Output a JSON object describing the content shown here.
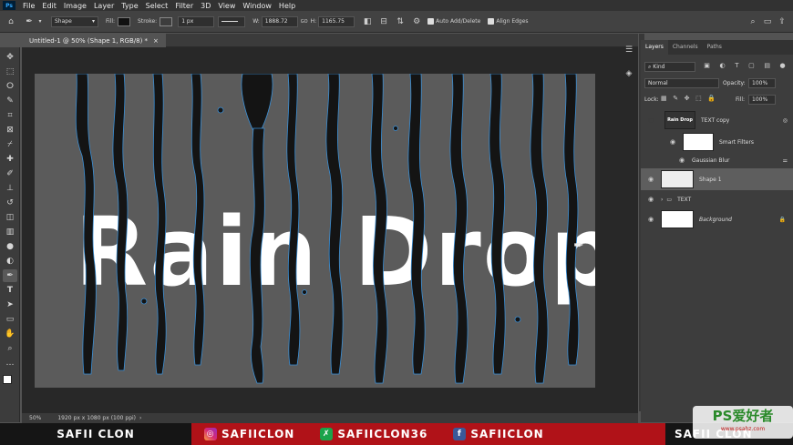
{
  "menubar": {
    "logo": "Ps",
    "items": [
      "File",
      "Edit",
      "Image",
      "Layer",
      "Type",
      "Select",
      "Filter",
      "3D",
      "View",
      "Window",
      "Help"
    ]
  },
  "options": {
    "mode": "Shape",
    "fill_label": "Fill:",
    "stroke_label": "Stroke:",
    "stroke_size": "1 px",
    "w_label": "W:",
    "w_value": "1888.72",
    "go_label": "GO",
    "h_label": "H:",
    "h_value": "1165.75",
    "auto_add": "Auto Add/Delete",
    "align_edges": "Align Edges"
  },
  "document": {
    "tab_title": "Untitled-1 @ 50% (Shape 1, RGB/8) *",
    "text": "Rain Drop"
  },
  "status": {
    "zoom": "50%",
    "info": "1920 px x 1080 px (100 ppi)"
  },
  "layers_panel": {
    "tabs": [
      "Layers",
      "Channels",
      "Paths"
    ],
    "kind": "Kind",
    "blend_mode": "Normal",
    "opacity_label": "Opacity:",
    "opacity_value": "100%",
    "lock_label": "Lock:",
    "fill_label": "Fill:",
    "fill_value": "100%",
    "layers": [
      {
        "name": "TEXT copy",
        "thumb_text": "Rain Drop"
      },
      {
        "name": "Smart Filters"
      },
      {
        "name": "Gaussian Blur"
      },
      {
        "name": "Shape 1"
      },
      {
        "name": "TEXT"
      },
      {
        "name": "Background"
      }
    ]
  },
  "banner": {
    "left_name": "SAFII CLON",
    "instagram": "SAFIICLON",
    "other": "SAFIICLON36",
    "facebook": "SAFIICLON",
    "right_name": "SAFII CLON"
  },
  "watermark": {
    "text": "PS爱好者",
    "url": "www.psahz.com"
  },
  "colors": {
    "accent": "#31a8ff",
    "banner_red": "#b01218",
    "path_blue": "#3a8fd6"
  }
}
